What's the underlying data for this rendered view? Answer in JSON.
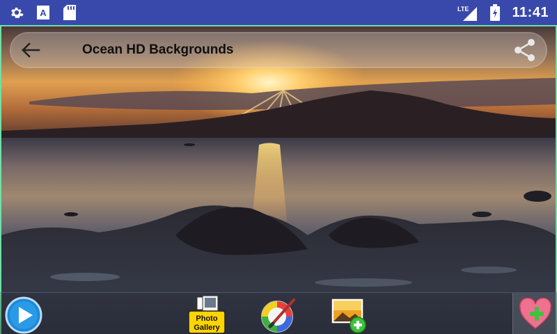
{
  "status_bar": {
    "time": "11:41",
    "network": "LTE",
    "icons": [
      "gear-icon",
      "font-a-icon",
      "sd-card-icon",
      "lte-signal-icon",
      "battery-icon"
    ]
  },
  "toolbar": {
    "title": "Ocean HD Backgrounds",
    "back_icon": "arrow-left-icon",
    "share_icon": "share-icon"
  },
  "bottom_bar": {
    "play_icon": "play-icon",
    "gallery_label_line1": "Photo",
    "gallery_label_line2": "Gallery",
    "paint_icon": "paint-icon",
    "add_image_icon": "add-image-icon",
    "favorite_icon": "heart-plus-icon"
  },
  "colors": {
    "status_bar": "#3949ab",
    "accent_border": "#6fe0a8",
    "gallery_yellow": "#ffd400",
    "favorite_green": "#3cc43c"
  }
}
